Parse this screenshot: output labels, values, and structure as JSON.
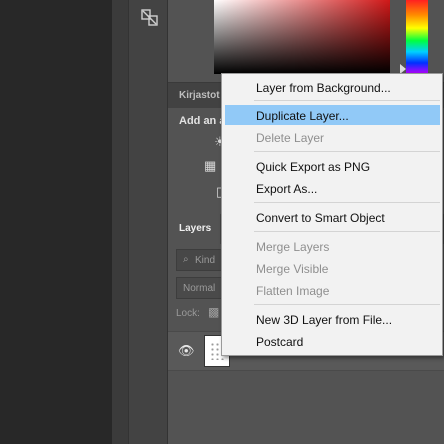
{
  "tool_panel": {
    "tool_icon": "layer-tool-icon"
  },
  "libraries": {
    "tab_label": "Kirjastot"
  },
  "adjustments": {
    "title": "Add an a"
  },
  "layers_panel": {
    "tab_label": "Layers",
    "filter": {
      "icon": "search-icon",
      "label": "Kind"
    },
    "blend_mode": "Normal",
    "lock_label": "Lock:",
    "layer_row": {
      "visibility_icon": "eye-icon"
    }
  },
  "context_menu": {
    "items": [
      {
        "label": "Layer from Background...",
        "enabled": true,
        "highlighted": false
      },
      {
        "label": "Duplicate Layer...",
        "enabled": true,
        "highlighted": true
      },
      {
        "label": "Delete Layer",
        "enabled": false,
        "highlighted": false
      },
      {
        "label": "Quick Export as PNG",
        "enabled": true,
        "highlighted": false
      },
      {
        "label": "Export As...",
        "enabled": true,
        "highlighted": false
      },
      {
        "label": "Convert to Smart Object",
        "enabled": true,
        "highlighted": false
      },
      {
        "label": "Merge Layers",
        "enabled": false,
        "highlighted": false
      },
      {
        "label": "Merge Visible",
        "enabled": false,
        "highlighted": false
      },
      {
        "label": "Flatten Image",
        "enabled": false,
        "highlighted": false
      },
      {
        "label": "New 3D Layer from File...",
        "enabled": true,
        "highlighted": false
      },
      {
        "label": "Postcard",
        "enabled": true,
        "highlighted": false
      }
    ],
    "highlight_color": "#91c9f7",
    "disabled_color": "#8f8f8f"
  }
}
